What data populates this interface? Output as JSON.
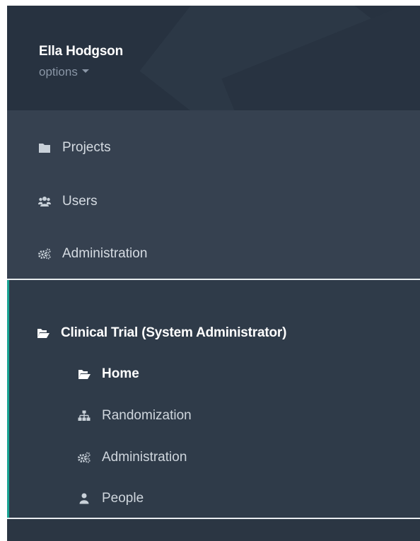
{
  "profile": {
    "name": "Ella Hodgson",
    "options_label": "options"
  },
  "main_nav": [
    {
      "label": "Projects",
      "icon": "folder-icon"
    },
    {
      "label": "Users",
      "icon": "users-icon"
    },
    {
      "label": "Administration",
      "icon": "cogs-icon"
    }
  ],
  "project": {
    "title": "Clinical Trial (System Administrator)",
    "items": [
      {
        "label": "Home",
        "icon": "folder-open-icon",
        "active": true
      },
      {
        "label": "Randomization",
        "icon": "sitemap-icon",
        "active": false
      },
      {
        "label": "Administration",
        "icon": "cogs-icon",
        "active": false
      },
      {
        "label": "People",
        "icon": "user-icon",
        "active": false
      }
    ]
  },
  "colors": {
    "sidebar_bg": "#2b3643",
    "header_bg": "#273240",
    "nav_bg": "#364150",
    "project_bg": "#2f3b49",
    "accent": "#1aa393",
    "separator": "#e8ecef"
  }
}
